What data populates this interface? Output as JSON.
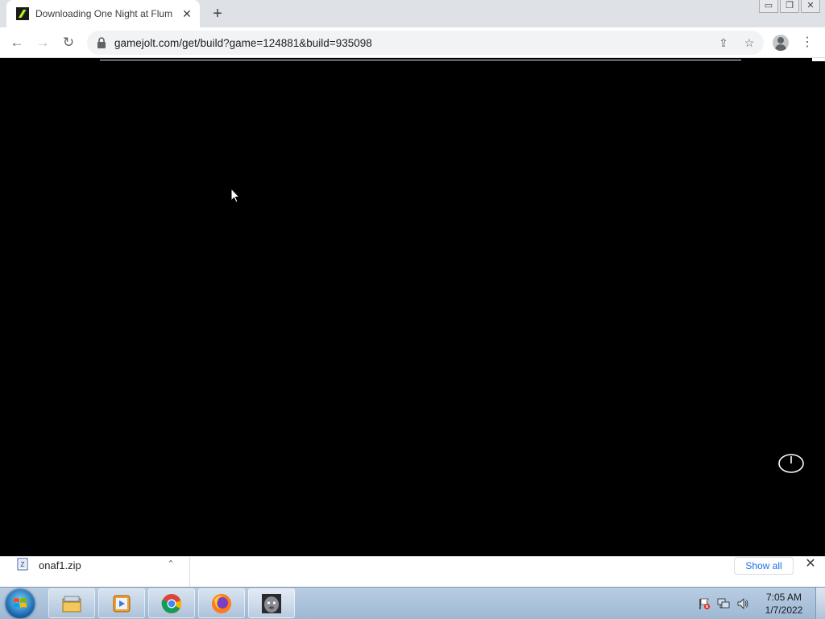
{
  "browser": {
    "tab": {
      "title": "Downloading One Night at Flum",
      "close_glyph": "✕",
      "favicon": "gamejolt-icon"
    },
    "new_tab_glyph": "+",
    "window_controls": {
      "minimize": "▭",
      "restore": "❐",
      "close": "✕"
    },
    "toolbar": {
      "back_glyph": "←",
      "forward_glyph": "→",
      "reload_glyph": "↻",
      "url": "gamejolt.com/get/build?game=124881&build=935098",
      "share_glyph": "⇪",
      "bookmark_glyph": "☆",
      "menu_glyph": "⋮"
    }
  },
  "page": {
    "background_color": "#000000",
    "power_icon": "power-icon"
  },
  "downloads": {
    "item": {
      "filename": "onaf1.zip",
      "chevron_glyph": "⌃"
    },
    "show_all_label": "Show all",
    "close_glyph": "✕"
  },
  "taskbar": {
    "pinned": [
      {
        "name": "windows-explorer-icon"
      },
      {
        "name": "media-player-icon"
      },
      {
        "name": "chrome-icon"
      },
      {
        "name": "firefox-icon"
      },
      {
        "name": "game-app-icon"
      }
    ],
    "clock": {
      "time": "7:05 AM",
      "date": "1/7/2022"
    }
  },
  "colors": {
    "accent_link": "#1a73e8",
    "taskbar": "#a9c0da"
  }
}
